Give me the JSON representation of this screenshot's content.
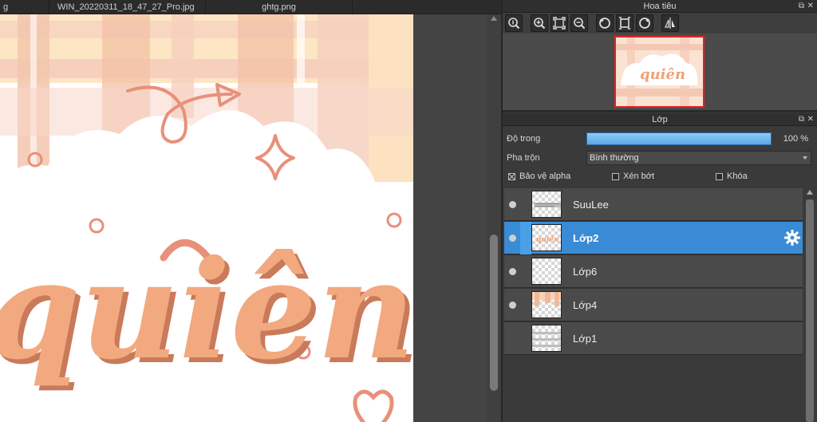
{
  "tabs": [
    {
      "label": "g"
    },
    {
      "label": "WIN_20220311_18_47_27_Pro.jpg"
    },
    {
      "label": "ghtg.png"
    }
  ],
  "navigator": {
    "title": "Hoa tiêu",
    "tools": [
      "zoom-actual-icon",
      "zoom-in-icon",
      "fit-screen-icon",
      "zoom-out-icon",
      "rotate-left-icon",
      "reset-rotate-icon",
      "rotate-right-icon",
      "flip-icon"
    ]
  },
  "layers_panel": {
    "title": "Lớp",
    "opacity_label": "Độ trong",
    "opacity_value": "100 %",
    "opacity_fraction": 1.0,
    "blend_label": "Pha trộn",
    "blend_value": "Bình thường",
    "protect_alpha": {
      "label": "Bảo vệ alpha",
      "checked": true
    },
    "clipping": {
      "label": "Xén bớt",
      "checked": false
    },
    "lock": {
      "label": "Khóa",
      "checked": false
    },
    "layers": [
      {
        "name": "SuuLee",
        "visible": true,
        "selected": false
      },
      {
        "name": "Lớp2",
        "visible": true,
        "selected": true
      },
      {
        "name": "Lớp6",
        "visible": true,
        "selected": false
      },
      {
        "name": "Lớp4",
        "visible": true,
        "selected": false
      },
      {
        "name": "Lớp1",
        "visible": false,
        "selected": false
      }
    ]
  },
  "artwork": {
    "text": "quiên",
    "colors": {
      "stripe": "#f6d0bd",
      "stripe_light": "#fde6c4",
      "accent": "#e8907a",
      "lettering": "#f2a97f",
      "lettering_shadow": "#c97a5a"
    }
  },
  "colors": {
    "selection": "#3a8bd6",
    "panel": "#3a3a3a",
    "nav_frame": "#e02424"
  }
}
